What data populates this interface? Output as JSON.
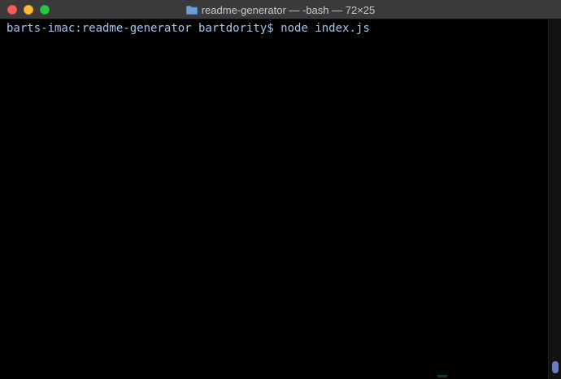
{
  "window": {
    "title": "readme-generator — -bash — 72×25",
    "title_icon": "folder-icon"
  },
  "terminal": {
    "prompt": "barts-imac:readme-generator bartdority$",
    "command": "node index.js"
  },
  "colors": {
    "background": "#000000",
    "text": "#a9c4ea",
    "titlebar": "#3a3a3c",
    "close": "#fe5f57",
    "minimize": "#febc2e",
    "zoom": "#28c840",
    "scroll_thumb": "#6a7cc4"
  }
}
